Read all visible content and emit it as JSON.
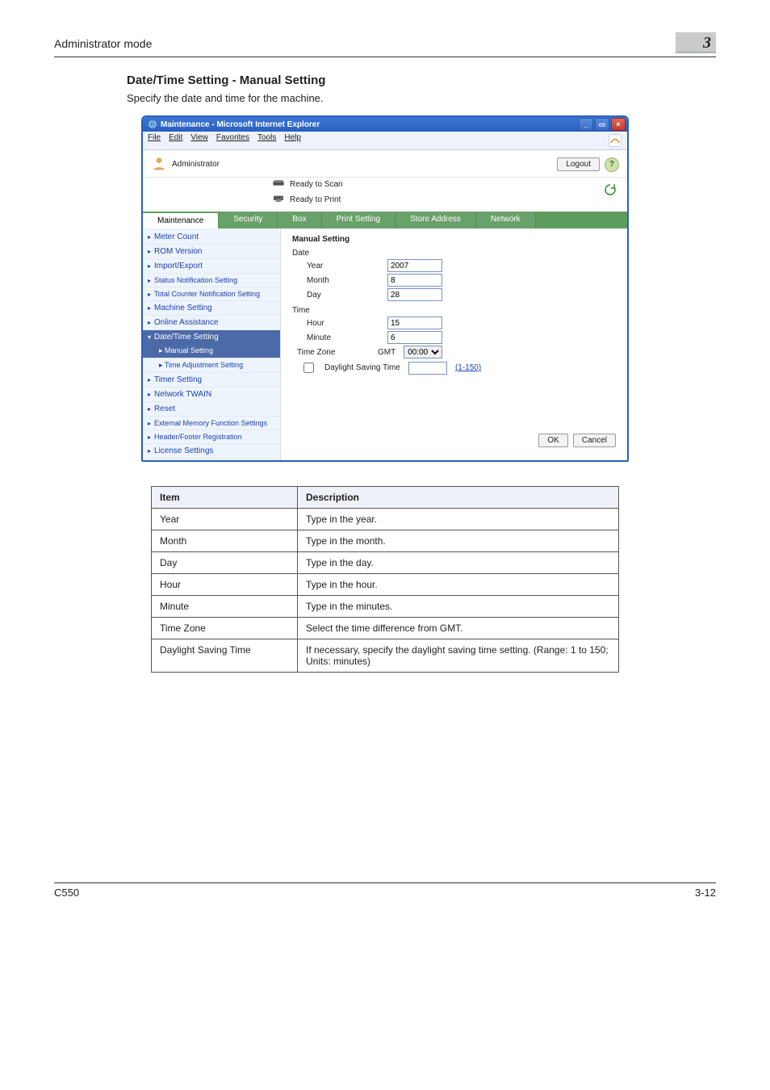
{
  "doc": {
    "crumb": "Administrator mode",
    "chapter_number": "3",
    "section_title": "Date/Time Setting - Manual Setting",
    "section_desc": "Specify the date and time for the machine.",
    "footer_model": "C550",
    "footer_page": "3-12"
  },
  "window": {
    "title": "Maintenance - Microsoft Internet Explorer",
    "menu": [
      "File",
      "Edit",
      "View",
      "Favorites",
      "Tools",
      "Help"
    ],
    "user_role": "Administrator",
    "logout_label": "Logout",
    "help_label": "?",
    "status_scan": "Ready to Scan",
    "status_print": "Ready to Print",
    "tabs": [
      "Maintenance",
      "Security",
      "Box",
      "Print Setting",
      "Store Address",
      "Network"
    ],
    "tabs_active_index": 0,
    "sidebar": {
      "items_top": [
        "Meter Count",
        "ROM Version",
        "Import/Export",
        "Status Notification Setting",
        "Total Counter Notification Setting",
        "Machine Setting",
        "Online Assistance"
      ],
      "expanded_label": "Date/Time Setting",
      "sub_manual": "Manual Setting",
      "sub_adjust": "Time Adjustment Setting",
      "items_bottom": [
        "Timer Setting",
        "Network TWAIN",
        "Reset",
        "External Memory Function Settings",
        "Header/Footer Registration",
        "License Settings"
      ]
    },
    "form": {
      "title": "Manual Setting",
      "date_label": "Date",
      "time_label": "Time",
      "year_label": "Year",
      "month_label": "Month",
      "day_label": "Day",
      "hour_label": "Hour",
      "minute_label": "Minute",
      "timezone_label": "Time Zone",
      "daylight_label": "Daylight Saving Time",
      "gmt_prefix": "GMT",
      "year_value": "2007",
      "month_value": "8",
      "day_value": "28",
      "hour_value": "15",
      "minute_value": "6",
      "tz_value": "00:00",
      "daylight_range": "(1-150)",
      "ok_label": "OK",
      "cancel_label": "Cancel"
    }
  },
  "table": {
    "head_item": "Item",
    "head_desc": "Description",
    "rows": [
      {
        "item": "Year",
        "desc": "Type in the year."
      },
      {
        "item": "Month",
        "desc": "Type in the month."
      },
      {
        "item": "Day",
        "desc": "Type in the day."
      },
      {
        "item": "Hour",
        "desc": "Type in the hour."
      },
      {
        "item": "Minute",
        "desc": "Type in the minutes."
      },
      {
        "item": "Time Zone",
        "desc": "Select the time difference from GMT."
      },
      {
        "item": "Daylight Saving Time",
        "desc": "If necessary, specify the daylight saving time setting. (Range: 1 to 150; Units: minutes)"
      }
    ]
  }
}
